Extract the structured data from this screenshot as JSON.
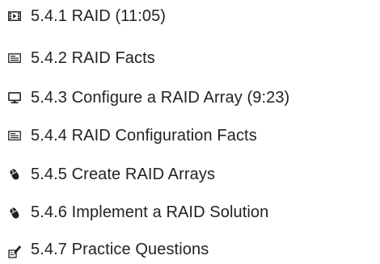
{
  "lesson_list": {
    "items": [
      {
        "icon": "video-icon",
        "label": "5.4.1 RAID (11:05)"
      },
      {
        "icon": "document-icon",
        "label": "5.4.2 RAID Facts"
      },
      {
        "icon": "monitor-icon",
        "label": "5.4.3 Configure a RAID Array (9:23)"
      },
      {
        "icon": "document-icon",
        "label": "5.4.4 RAID Configuration Facts"
      },
      {
        "icon": "mouse-icon",
        "label": "5.4.5 Create RAID Arrays"
      },
      {
        "icon": "mouse-icon",
        "label": "5.4.6 Implement a RAID Solution"
      },
      {
        "icon": "exam-icon",
        "label": "5.4.7 Practice Questions"
      }
    ]
  }
}
